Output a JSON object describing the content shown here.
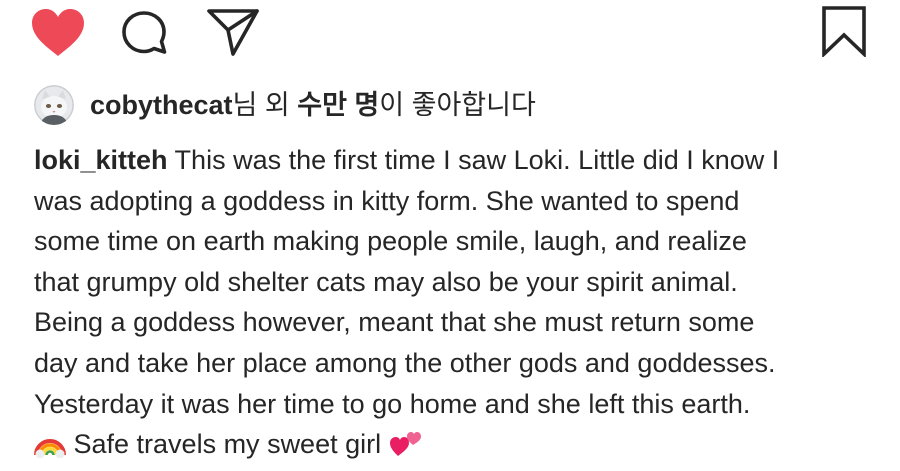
{
  "actions": {
    "like_icon": "heart-filled-icon",
    "comment_icon": "comment-icon",
    "share_icon": "paper-plane-icon",
    "save_icon": "bookmark-icon",
    "liked_color": "#ed4956"
  },
  "likes": {
    "username": "cobythecat",
    "suffix_1": "님 외 ",
    "count_bold": "수만 명",
    "suffix_2": "이 좋아합니다"
  },
  "caption": {
    "author": "loki_kitteh",
    "lines": [
      " This was the first time I saw Loki. Little did I know I",
      "was adopting a goddess in kitty form. She wanted to spend",
      "some time on earth making people smile, laugh, and realize",
      "that grumpy old shelter cats may also be your spirit animal.",
      "Being a goddess however, meant that she must return some",
      "day and take her place among the other gods and goddesses.",
      "Yesterday it was her time to go home and she left this earth.",
      " Safe travels my sweet girl "
    ],
    "emoji_start": "rainbow-icon",
    "emoji_end": "two-hearts-icon"
  }
}
